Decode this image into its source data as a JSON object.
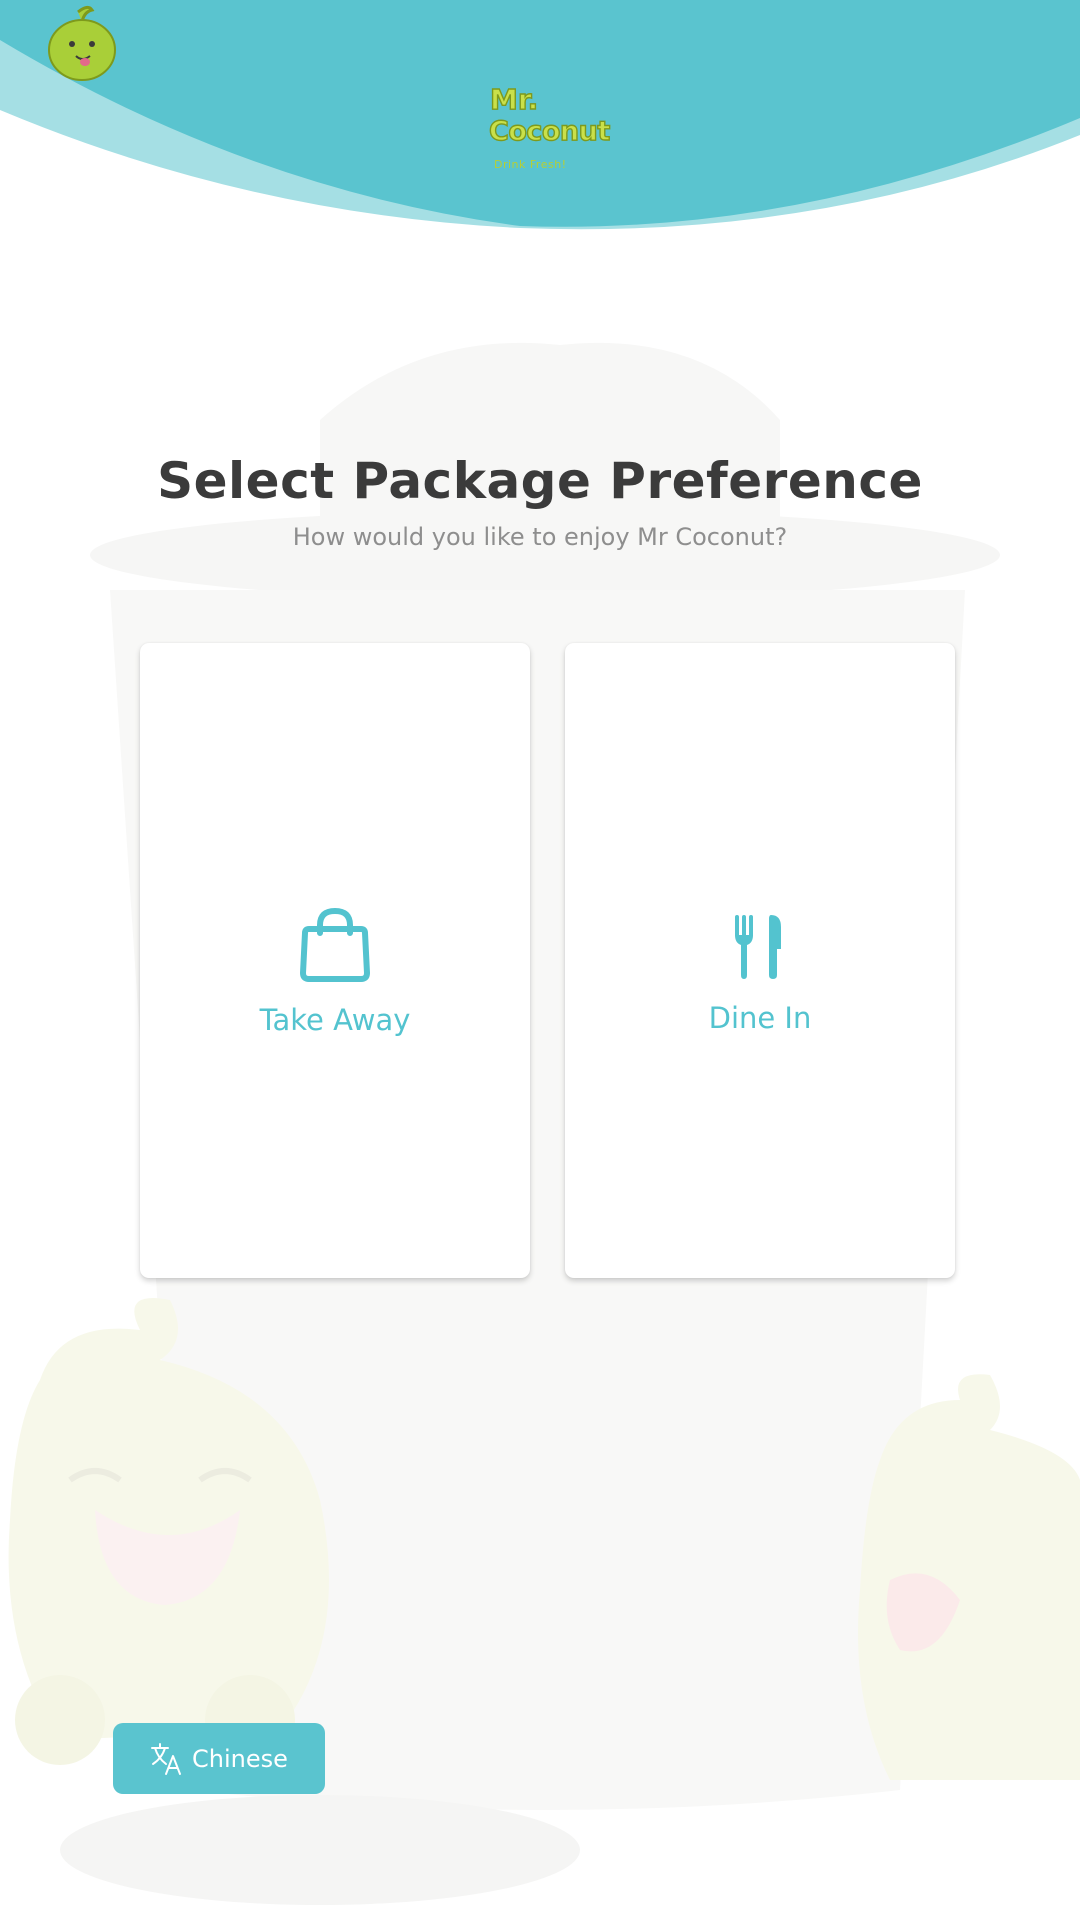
{
  "brand": {
    "logo_line1": "Mr.",
    "logo_line2": "Coconut",
    "tagline": "Drink Fresh!",
    "primary_color": "#5ac4cf",
    "logo_green": "#a9cf38"
  },
  "page": {
    "title": "Select Package Preference",
    "subtitle": "How would you like to enjoy Mr Coconut?"
  },
  "options": [
    {
      "label": "Take Away",
      "icon": "shopping-bag-icon"
    },
    {
      "label": "Dine In",
      "icon": "fork-knife-icon"
    }
  ],
  "language_button": {
    "label": "Chinese",
    "icon": "translate-icon"
  }
}
